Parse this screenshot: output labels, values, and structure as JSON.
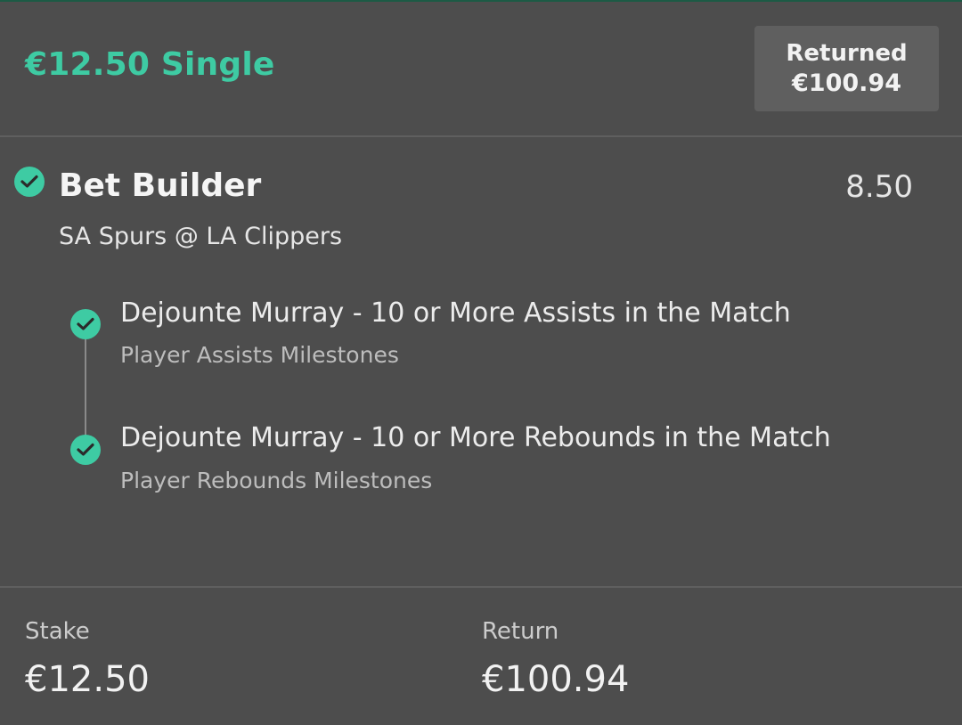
{
  "bet": {
    "title": "€12.50 Single",
    "returned_label": "Returned",
    "returned_value": "€100.94",
    "market": "Bet Builder",
    "odds": "8.50",
    "event": "SA Spurs @ LA Clippers",
    "status_icon": "check-circle-icon",
    "legs": [
      {
        "selection": "Dejounte Murray - 10 or More Assists in the Match",
        "market": "Player Assists Milestones",
        "status_icon": "check-circle-icon"
      },
      {
        "selection": "Dejounte Murray - 10 or More Rebounds in the Match",
        "market": "Player Rebounds Milestones",
        "status_icon": "check-circle-icon"
      }
    ]
  },
  "footer": {
    "stake_label": "Stake",
    "stake_value": "€12.50",
    "return_label": "Return",
    "return_value": "€100.94"
  },
  "colors": {
    "background": "#4d4d4d",
    "accent": "#3ecba3",
    "returned_box": "#5f5f5f"
  }
}
